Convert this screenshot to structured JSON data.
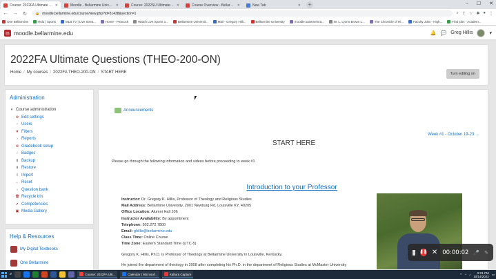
{
  "browser": {
    "tabs": [
      {
        "title": "Course: 2022FA Ultimate Questi",
        "active": true
      },
      {
        "title": "Moodle - Bellarmine University",
        "active": false
      },
      {
        "title": "Course: 2022SU Ultimate Questi",
        "active": false
      },
      {
        "title": "Course Overview - Bellarmine U",
        "active": false
      },
      {
        "title": "New Tab",
        "active": false
      }
    ],
    "url": "moodle.bellarmine.edu/course/view.php?id=31438&section=1",
    "bookmarks": [
      "One Bellarmine",
      "Hulu | Sports",
      "MLB.TV | Live Strea...",
      "Home - Peacock",
      "Watch Live Sports o...",
      "Bellarmine Universit...",
      "Mail - Gregory Hilli...",
      "Bellarmine University",
      "moodle.saintmeinra...",
      "W. L. Lyons Brown L...",
      "The Chronicle of Hi...",
      "Faculty Jobs - High...",
      "Find jobs - Academ..."
    ]
  },
  "navbar": {
    "site_name": "moodle.bellarmine.edu",
    "user_name": "Greg Hillis"
  },
  "header": {
    "course_title": "2022FA Ultimate Questions (THEO-200-ON)",
    "breadcrumb": [
      "Home",
      "My courses",
      "2022FA THEO-200-ON",
      "START HERE"
    ],
    "editing_button": "Turn editing on"
  },
  "admin": {
    "title": "Administration",
    "root": "Course administration",
    "items": [
      {
        "label": "Edit settings",
        "icon": "gear-icon"
      },
      {
        "label": "Users",
        "icon": "caret-right-icon"
      },
      {
        "label": "Filters",
        "icon": "filter-icon"
      },
      {
        "label": "Reports",
        "icon": "caret-right-icon"
      },
      {
        "label": "Gradebook setup",
        "icon": "gear-icon"
      },
      {
        "label": "Badges",
        "icon": "caret-right-icon"
      },
      {
        "label": "Backup",
        "icon": "backup-icon"
      },
      {
        "label": "Restore",
        "icon": "restore-icon"
      },
      {
        "label": "Import",
        "icon": "import-icon"
      },
      {
        "label": "Reset",
        "icon": "reset-icon"
      },
      {
        "label": "Question bank",
        "icon": "caret-right-icon"
      },
      {
        "label": "Recycle bin",
        "icon": "trash-icon"
      },
      {
        "label": "Competencies",
        "icon": "competencies-icon"
      },
      {
        "label": "Media Gallery",
        "icon": "media-icon"
      }
    ]
  },
  "help": {
    "title": "Help & Resources",
    "items": [
      "My Digital Textbooks",
      "One Bellarmine"
    ]
  },
  "main": {
    "announcements": "Announcements",
    "week_link": "Week #1 - October 19-23",
    "section_title": "START HERE",
    "intro": "Please go through the following information and videos before proceeding to week #1",
    "heading": "Introduction to your Professor",
    "instructor": {
      "instructor_label": "Instructor:",
      "instructor_value": "Dr. Gregory K. Hillis, Professor of Theology and Religious Studies",
      "mail_label": "Mail Address:",
      "mail_value": "Bellarmine University, 2001 Newburg Rd, Louisville KY, 40205",
      "office_label": "Office Location:",
      "office_value": "Alumni Hall 106",
      "avail_label": "Instructor Availability:",
      "avail_value": "By appointment",
      "phone_label": "Telephone:",
      "phone_value": "502.272.7800",
      "email_label": "Email:",
      "email_value": "ghillis@bellarmine.edu",
      "class_label": "Class Time:",
      "class_value": "Online Course",
      "tz_label": "Time Zone:",
      "tz_value": "Eastern Standard Time (UTC-5)"
    },
    "bio1": "Gregory K. Hillis, Ph.D. is Professor of Theology at Bellarmine University in Louisville, Kentucky.",
    "bio2": "He joined the department of theology in 2008 after completing his Ph.D. in the department of Religious Studies at McMaster University"
  },
  "recorder": {
    "time": "00:00:02"
  },
  "taskbar": {
    "tasks": [
      "Course: 2022FA Ulti...",
      "Calendar | Microsof...",
      "Kaltura Capture"
    ],
    "time": "5:21 PM",
    "date": "10/14/2022"
  },
  "colors": {
    "link": "#0f6fc5",
    "moodle_red": "#b4292e",
    "record_red": "#e23b3b"
  }
}
